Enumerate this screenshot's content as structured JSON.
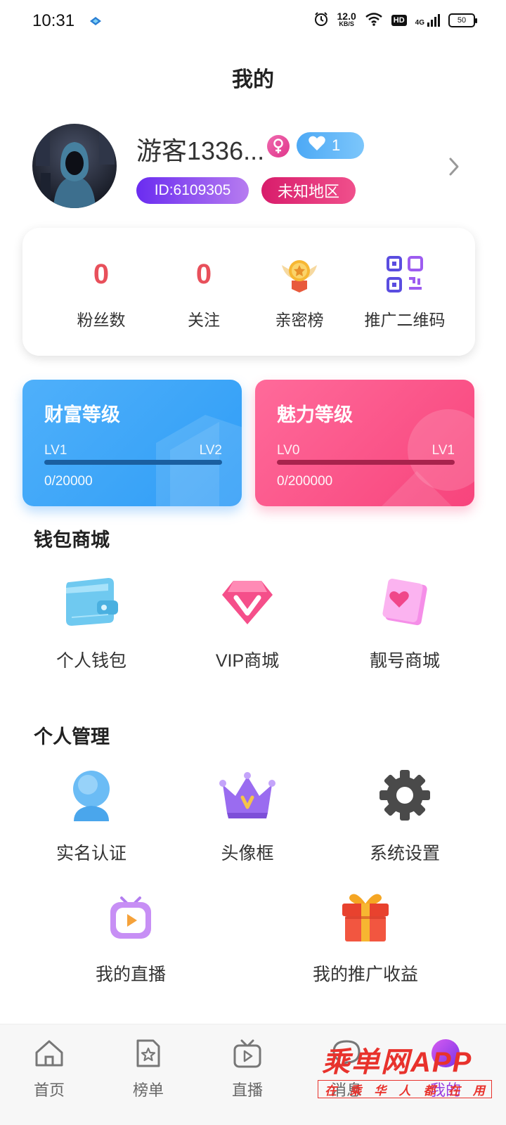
{
  "status_bar": {
    "time": "10:31",
    "net_speed_value": "12.0",
    "net_speed_unit": "KB/S",
    "hd": "HD",
    "signal": "4G",
    "battery": "50"
  },
  "page_title": "我的",
  "profile": {
    "username": "游客1336...",
    "heart_count": "1",
    "id_label": "ID:6109305",
    "region": "未知地区"
  },
  "stats": [
    {
      "value": "0",
      "label": "粉丝数"
    },
    {
      "value": "0",
      "label": "关注"
    },
    {
      "icon": "trophy-medal-icon",
      "label": "亲密榜"
    },
    {
      "icon": "qr-code-icon",
      "label": "推广二维码"
    }
  ],
  "levels": {
    "wealth": {
      "title": "财富等级",
      "current": "LV1",
      "next": "LV2",
      "progress_text": "0/20000",
      "progress": 0
    },
    "charm": {
      "title": "魅力等级",
      "current": "LV0",
      "next": "LV1",
      "progress_text": "0/200000",
      "progress": 0
    }
  },
  "wallet_section": {
    "title": "钱包商城",
    "items": [
      {
        "label": "个人钱包",
        "icon": "wallet-icon"
      },
      {
        "label": "VIP商城",
        "icon": "diamond-icon"
      },
      {
        "label": "靓号商城",
        "icon": "heart-card-icon"
      }
    ]
  },
  "personal_section": {
    "title": "个人管理",
    "items": [
      {
        "label": "实名认证",
        "icon": "person-icon"
      },
      {
        "label": "头像框",
        "icon": "crown-icon"
      },
      {
        "label": "系统设置",
        "icon": "gear-icon"
      },
      {
        "label": "我的直播",
        "icon": "tv-play-icon"
      },
      {
        "label": "我的推广收益",
        "icon": "gift-box-icon"
      }
    ]
  },
  "bottom_nav": [
    {
      "label": "首页",
      "icon": "home-icon"
    },
    {
      "label": "榜单",
      "icon": "ranking-icon"
    },
    {
      "label": "直播",
      "icon": "tv-icon"
    },
    {
      "label": "消息",
      "icon": "message-icon"
    },
    {
      "label": "我的",
      "icon": "profile-icon",
      "active": true
    }
  ],
  "watermark": {
    "main": "乘单网APP",
    "sub": [
      "在",
      "乘",
      "华",
      "人",
      "都",
      "在",
      "用"
    ]
  },
  "colors": {
    "stat_value": "#e8505b",
    "wealth_gradient": "#3aa3f8",
    "charm_gradient": "#f8507f",
    "nav_active": "#9b3fe0"
  }
}
